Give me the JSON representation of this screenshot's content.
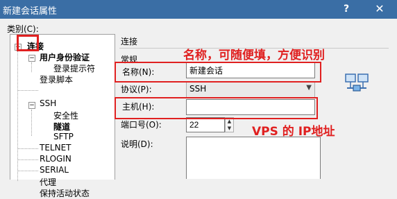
{
  "window": {
    "title": "新建会话属性",
    "help": "?",
    "close": "✕"
  },
  "category_label": "类别(C):",
  "tree": [
    {
      "label": "连接"
    },
    {
      "label": "用户身份验证"
    },
    {
      "label": "登录提示符"
    },
    {
      "label": "登录脚本"
    },
    {
      "label": "SSH"
    },
    {
      "label": "安全性"
    },
    {
      "label": "隧道"
    },
    {
      "label": "SFTP"
    },
    {
      "label": "TELNET"
    },
    {
      "label": "RLOGIN"
    },
    {
      "label": "SERIAL"
    },
    {
      "label": "代理"
    },
    {
      "label": "保持活动状态"
    }
  ],
  "panel": {
    "header": "连接",
    "group": "常规",
    "name_label": "名称(N):",
    "name_value": "新建会话",
    "protocol_label": "协议(P):",
    "protocol_value": "SSH",
    "host_label": "主机(H):",
    "host_value": "",
    "port_label": "端口号(O):",
    "port_value": "22",
    "desc_label": "说明(D):",
    "desc_value": ""
  },
  "annotations": {
    "name_hint": "名称，可随便填，方便识别",
    "host_hint": "VPS 的 IP地址"
  },
  "colors": {
    "annotation": "#e02020",
    "titlebar": "#3a6ea5"
  }
}
